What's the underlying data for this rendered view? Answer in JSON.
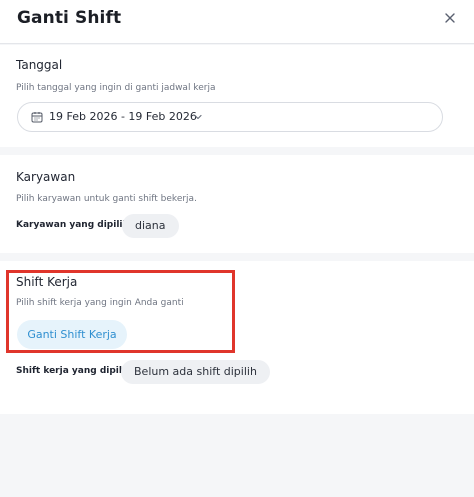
{
  "header": {
    "title": "Ganti Shift"
  },
  "date_section": {
    "title": "Tanggal",
    "subtitle": "Pilih tanggal yang ingin di ganti jadwal kerja",
    "range": "19 Feb 2026 - 19 Feb 2026"
  },
  "employee_section": {
    "title": "Karyawan",
    "subtitle": "Pilih karyawan untuk ganti shift bekerja.",
    "selected_label": "Karyawan yang dipilih:",
    "selected_value": "diana"
  },
  "shift_section": {
    "title": "Shift Kerja",
    "subtitle": "Pilih shift kerja yang ingin Anda ganti",
    "button_label": "Ganti Shift Kerja",
    "selected_label": "Shift kerja yang dipilih:",
    "selected_value": "Belum ada shift dipilih"
  },
  "colors": {
    "accent": "#2f8fd0",
    "accent_bg": "#e6f3fb",
    "highlight": "#e0352b"
  },
  "icons": [
    "close-icon",
    "calendar-icon",
    "chevron-down-icon"
  ]
}
